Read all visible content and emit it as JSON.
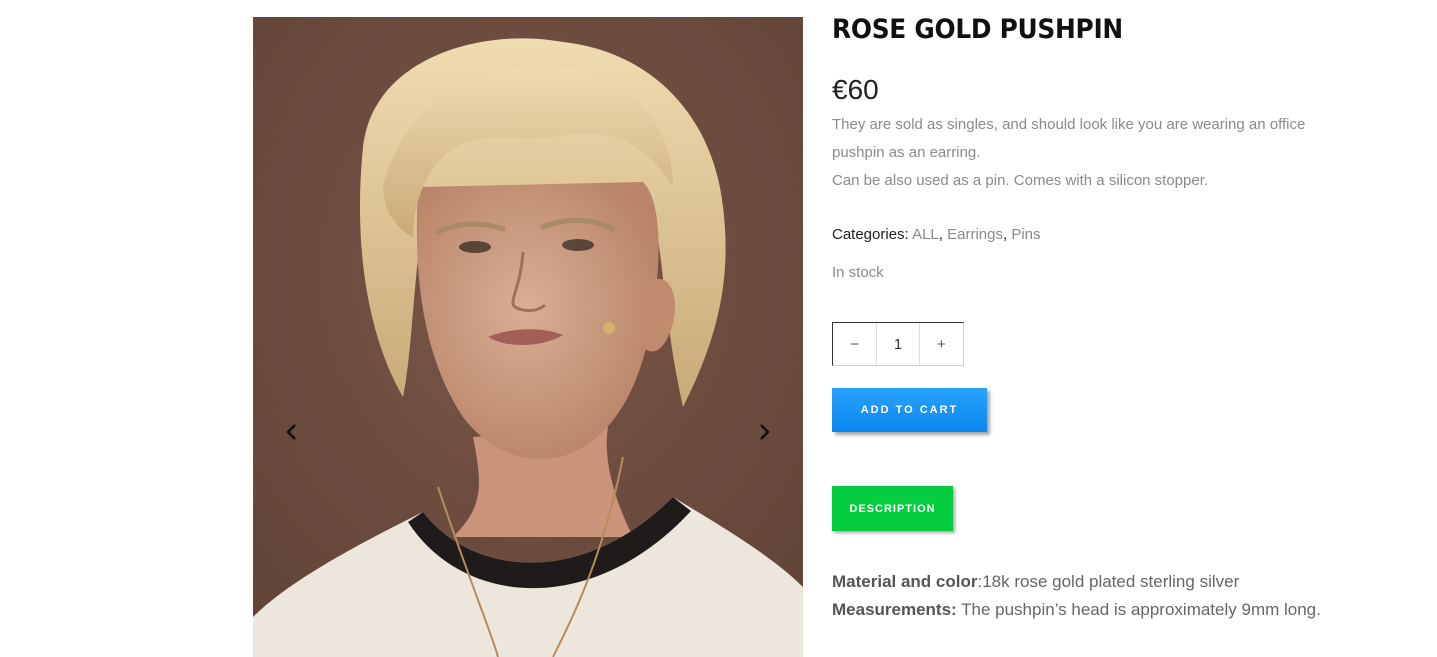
{
  "product": {
    "title": "ROSE GOLD PUSHPIN",
    "price": "€60",
    "short_description": [
      "They are sold as singles, and should look like you are wearing an office pushpin as an earring.",
      "Can be also used as a pin. Comes with a silicon stopper."
    ],
    "categories_label": "Categories:",
    "categories": [
      "ALL",
      "Earrings",
      "Pins"
    ],
    "category_separator": ", ",
    "stock_status": "In stock",
    "quantity": "1"
  },
  "quantity_stepper": {
    "minus_label": "−",
    "plus_label": "+"
  },
  "actions": {
    "add_to_cart_label": "ADD TO CART"
  },
  "tabs": {
    "description_label": "DESCRIPTION"
  },
  "description": {
    "material_label": "Material and color",
    "material_value": ":18k rose gold plated sterling silver",
    "measurements_label": "Measurements:",
    "measurements_value": " The pushpin’s head is approximately 9mm long."
  },
  "gallery": {
    "prev_icon": "chevron-left-icon",
    "next_icon": "chevron-right-icon"
  },
  "colors": {
    "add_to_cart": "#0a8ff5",
    "description_tab": "#06cc3f",
    "photo_background": "#6b4a3e"
  }
}
